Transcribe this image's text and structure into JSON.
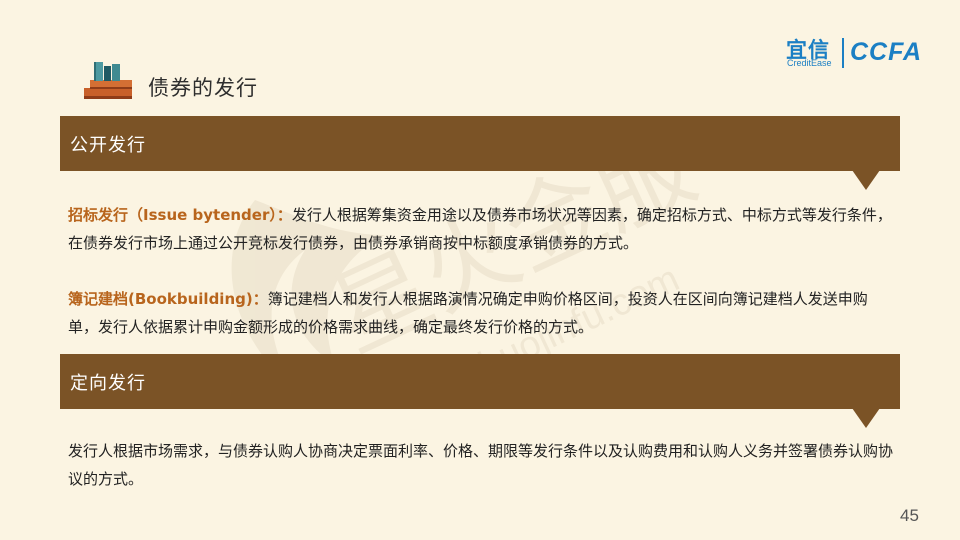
{
  "header": {
    "title": "债券的发行",
    "logo": {
      "brand_cn": "宜信",
      "brand_en": "CreditEase",
      "partner": "CCFA",
      "color": "#1b7fc4"
    }
  },
  "watermark": {
    "text_cn": "星火金服",
    "text_en": "xinghuojinfu.com"
  },
  "sections": [
    {
      "heading": "公开发行",
      "paragraphs": [
        {
          "term": "招标发行（Issue bytender）：",
          "text": "发行人根据筹集资金用途以及债券市场状况等因素，确定招标方式、中标方式等发行条件，在债券发行市场上通过公开竞标发行债券，由债券承销商按中标额度承销债券的方式。"
        },
        {
          "term": "簿记建档(Bookbuilding)：",
          "text": "簿记建档人和发行人根据路演情况确定申购价格区间，投资人在区间向簿记建档人发送申购单，发行人依据累计申购金额形成的价格需求曲线，确定最终发行价格的方式。"
        }
      ]
    },
    {
      "heading": "定向发行",
      "paragraphs": [
        {
          "term": "",
          "text": "发行人根据市场需求，与债券认购人协商决定票面利率、价格、期限等发行条件以及认购费用和认购人义务并签署债券认购协议的方式。"
        }
      ]
    }
  ],
  "footer": {
    "page_number": "45"
  },
  "colors": {
    "background": "#fbf4e2",
    "band": "#7b5326",
    "term": "#b8651d"
  }
}
